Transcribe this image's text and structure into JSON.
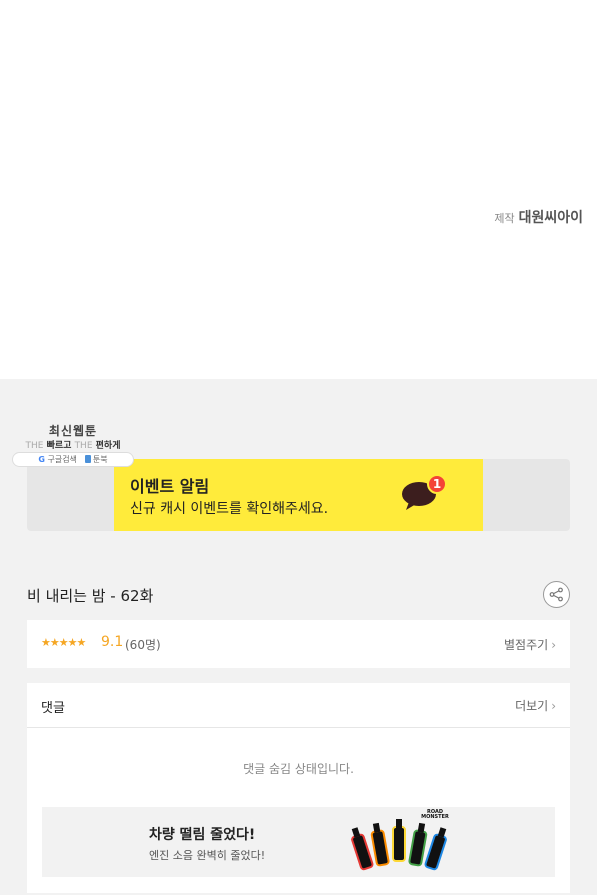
{
  "producer": {
    "label": "제작",
    "name": "대원씨아이"
  },
  "watermark": {
    "title": "최신웹툰",
    "the1": "THE",
    "fast": "빠르고",
    "the2": "THE",
    "easy": "편하게",
    "google_label": "구글검색",
    "toon_label": "툰북"
  },
  "event_banner": {
    "title": "이벤트 알림",
    "description": "신규 캐시 이벤트를 확인해주세요.",
    "badge_count": "1",
    "accent_color": "#ffeb3b",
    "badge_color": "#f44336"
  },
  "episode": {
    "title": "비 내리는 밤 - 62화"
  },
  "rating": {
    "stars": "★★★★★",
    "score": "9.1",
    "count": "(60명)",
    "rate_label": "별점주기",
    "star_color": "#f5a623"
  },
  "comments": {
    "title": "댓글",
    "more_label": "더보기",
    "hidden_message": "댓글 숨김 상태입니다."
  },
  "ad": {
    "title": "차량 떨림 줄었다!",
    "subtitle": "엔진 소음 완벽히 줄었다!",
    "brand": "ROAD MONSTER"
  }
}
